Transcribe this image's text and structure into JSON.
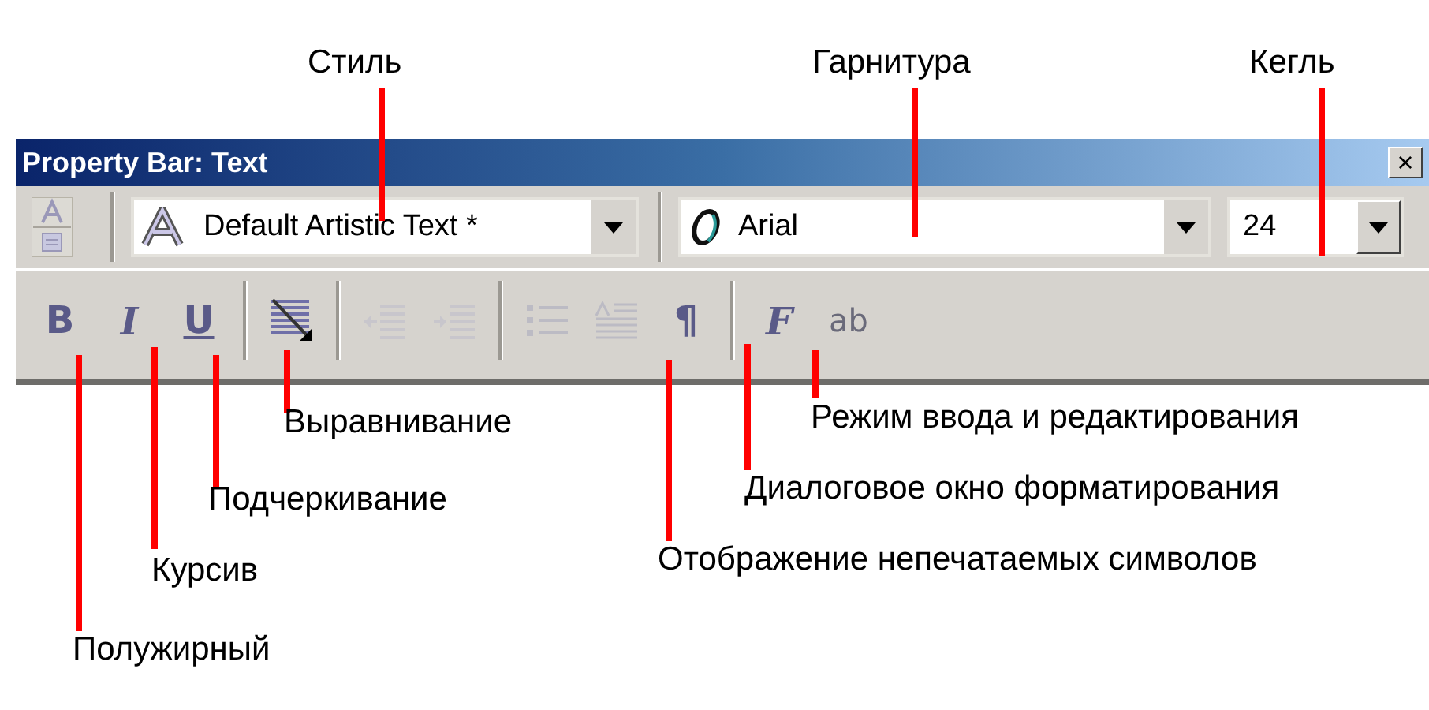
{
  "window": {
    "title": "Property Bar: Text",
    "close_glyph": "×"
  },
  "style_combo": {
    "value": "Default Artistic Text *"
  },
  "font_combo": {
    "value": "Arial"
  },
  "size_combo": {
    "value": "24"
  },
  "buttons": [
    {
      "kind": "bold",
      "glyph": "B",
      "disabled": false
    },
    {
      "kind": "italic",
      "glyph": "I",
      "disabled": false
    },
    {
      "kind": "underline",
      "glyph": "U",
      "disabled": false
    },
    {
      "kind": "align",
      "disabled": false
    },
    {
      "kind": "outdent",
      "disabled": true
    },
    {
      "kind": "indent",
      "disabled": true
    },
    {
      "kind": "bullets",
      "disabled": true
    },
    {
      "kind": "dropcap",
      "disabled": true
    },
    {
      "kind": "pilcrow",
      "glyph": "¶",
      "disabled": false
    },
    {
      "kind": "format",
      "glyph": "F",
      "disabled": false
    },
    {
      "kind": "edit",
      "glyph": "ab",
      "disabled": false
    }
  ],
  "callouts": [
    {
      "label": "Стиль"
    },
    {
      "label": "Гарнитура"
    },
    {
      "label": "Кегль"
    },
    {
      "label": "Выравнивание"
    },
    {
      "label": "Режим ввода и редактирования"
    },
    {
      "label": "Подчеркивание"
    },
    {
      "label": "Диалоговое окно форматирования"
    },
    {
      "label": "Курсив"
    },
    {
      "label": "Отображение непечатаемых символов"
    },
    {
      "label": "Полужирный"
    }
  ]
}
